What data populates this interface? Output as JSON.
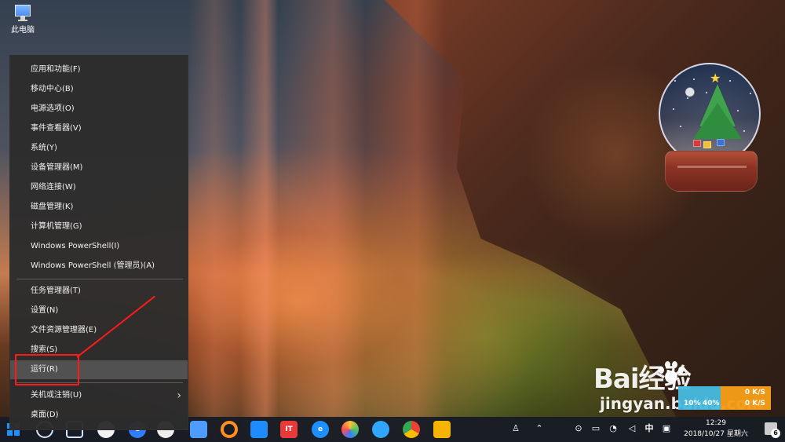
{
  "desktop": {
    "this_pc_label": "此电脑"
  },
  "context_menu": {
    "items": [
      {
        "label": "应用和功能(F)"
      },
      {
        "label": "移动中心(B)"
      },
      {
        "label": "电源选项(O)"
      },
      {
        "label": "事件查看器(V)"
      },
      {
        "label": "系统(Y)"
      },
      {
        "label": "设备管理器(M)"
      },
      {
        "label": "网络连接(W)"
      },
      {
        "label": "磁盘管理(K)"
      },
      {
        "label": "计算机管理(G)"
      },
      {
        "label": "Windows PowerShell(I)"
      },
      {
        "label": "Windows PowerShell (管理员)(A)"
      },
      {
        "label": "任务管理器(T)"
      },
      {
        "label": "设置(N)"
      },
      {
        "label": "文件资源管理器(E)"
      },
      {
        "label": "搜索(S)"
      },
      {
        "label": "运行(R)",
        "selected": true
      },
      {
        "label": "关机或注销(U)",
        "has_submenu": true
      },
      {
        "label": "桌面(D)"
      }
    ]
  },
  "watermark": {
    "brand": "Bai经验",
    "url": "jingyan.baidu.com"
  },
  "network_widget": {
    "cpu_percent": "10%",
    "memory_percent": "40%",
    "upload_speed": "0 K/S",
    "download_speed": "0 K/S"
  },
  "taskbar": {
    "icons": [
      {
        "name": "search-icon"
      },
      {
        "name": "task-view-icon"
      },
      {
        "name": "wechat-icon"
      },
      {
        "name": "qq-browser-icon"
      },
      {
        "name": "qq-icon"
      },
      {
        "name": "feishu-icon"
      },
      {
        "name": "search-orange-icon"
      },
      {
        "name": "windows-store-icon"
      },
      {
        "name": "media-icon"
      },
      {
        "name": "internet-explorer-icon"
      },
      {
        "name": "photo-icon"
      },
      {
        "name": "qq-blue-icon"
      },
      {
        "name": "chrome-icon"
      },
      {
        "name": "file-explorer-icon"
      }
    ],
    "ime_label": "中",
    "time": "12:29",
    "date": "2018/10/27 星期六",
    "notification_count": "6"
  },
  "colors": {
    "menu_background": "#2c2c2c",
    "menu_highlight": "#515151",
    "annotation": "#ff1a1a",
    "network_blue": "#47bcdf",
    "network_orange": "#f59c18"
  }
}
